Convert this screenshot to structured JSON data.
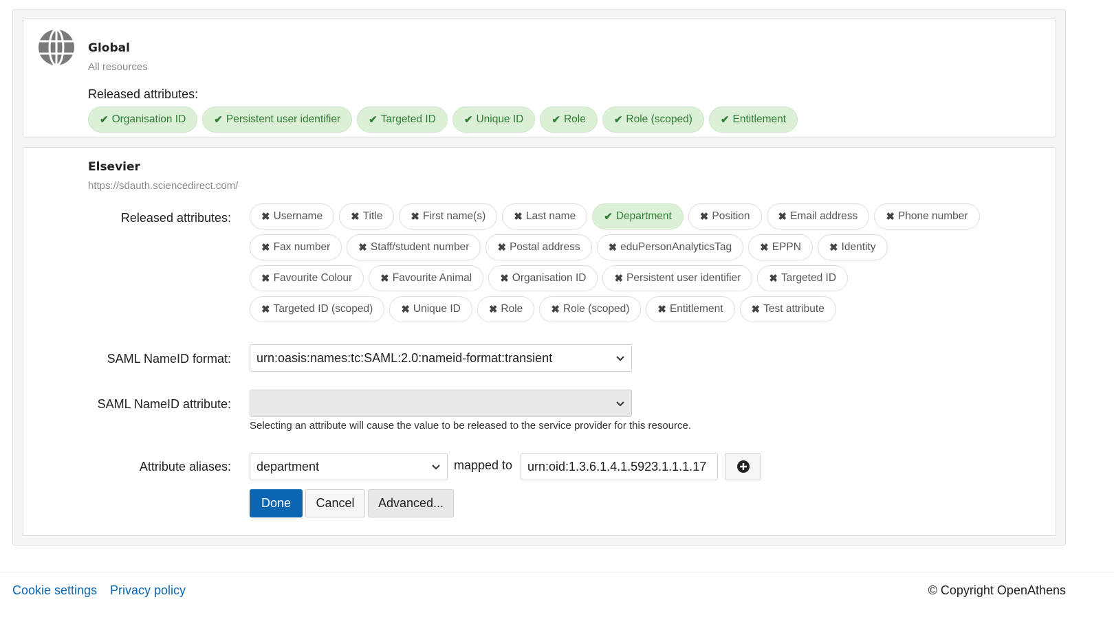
{
  "global": {
    "icon": "globe-icon",
    "title": "Global",
    "subtitle": "All resources",
    "released_label": "Released attributes:",
    "attributes": [
      {
        "label": "Organisation ID",
        "released": true
      },
      {
        "label": "Persistent user identifier",
        "released": true
      },
      {
        "label": "Targeted ID",
        "released": true
      },
      {
        "label": "Unique ID",
        "released": true
      },
      {
        "label": "Role",
        "released": true
      },
      {
        "label": "Role (scoped)",
        "released": true
      },
      {
        "label": "Entitlement",
        "released": true
      }
    ]
  },
  "resource": {
    "title": "Elsevier",
    "url": "https://sdauth.sciencedirect.com/",
    "released_label": "Released attributes:",
    "attribute_rows": [
      [
        {
          "label": "Username",
          "released": false
        },
        {
          "label": "Title",
          "released": false
        },
        {
          "label": "First name(s)",
          "released": false
        },
        {
          "label": "Last name",
          "released": false
        },
        {
          "label": "Department",
          "released": true
        },
        {
          "label": "Position",
          "released": false
        },
        {
          "label": "Email address",
          "released": false
        },
        {
          "label": "Phone number",
          "released": false
        }
      ],
      [
        {
          "label": "Fax number",
          "released": false
        },
        {
          "label": "Staff/student number",
          "released": false
        },
        {
          "label": "Postal address",
          "released": false
        },
        {
          "label": "eduPersonAnalyticsTag",
          "released": false
        },
        {
          "label": "EPPN",
          "released": false
        },
        {
          "label": "Identity",
          "released": false
        }
      ],
      [
        {
          "label": "Favourite Colour",
          "released": false
        },
        {
          "label": "Favourite Animal",
          "released": false
        },
        {
          "label": "Organisation ID",
          "released": false
        },
        {
          "label": "Persistent user identifier",
          "released": false
        },
        {
          "label": "Targeted ID",
          "released": false
        }
      ],
      [
        {
          "label": "Targeted ID (scoped)",
          "released": false
        },
        {
          "label": "Unique ID",
          "released": false
        },
        {
          "label": "Role",
          "released": false
        },
        {
          "label": "Role (scoped)",
          "released": false
        },
        {
          "label": "Entitlement",
          "released": false
        },
        {
          "label": "Test attribute",
          "released": false
        }
      ]
    ],
    "nameid_format_label": "SAML NameID format:",
    "nameid_format_value": "urn:oasis:names:tc:SAML:2.0:nameid-format:transient",
    "nameid_attribute_label": "SAML NameID attribute:",
    "nameid_attribute_value": "",
    "nameid_help": "Selecting an attribute will cause the value to be released to the service provider for this resource.",
    "aliases_label": "Attribute aliases:",
    "alias_select_value": "department",
    "mapped_to_label": "mapped to",
    "alias_value": "urn:oid:1.3.6.1.4.1.5923.1.1.1.17",
    "add_alias_icon": "plus-circle-icon",
    "done_label": "Done",
    "cancel_label": "Cancel",
    "advanced_label": "Advanced..."
  },
  "footer": {
    "cookie_label": "Cookie settings",
    "privacy_label": "Privacy policy",
    "copyright": "© Copyright OpenAthens"
  },
  "colors": {
    "primary": "#0b65b0",
    "released_bg": "#dcf0d8",
    "released_text": "#2e7d32"
  }
}
